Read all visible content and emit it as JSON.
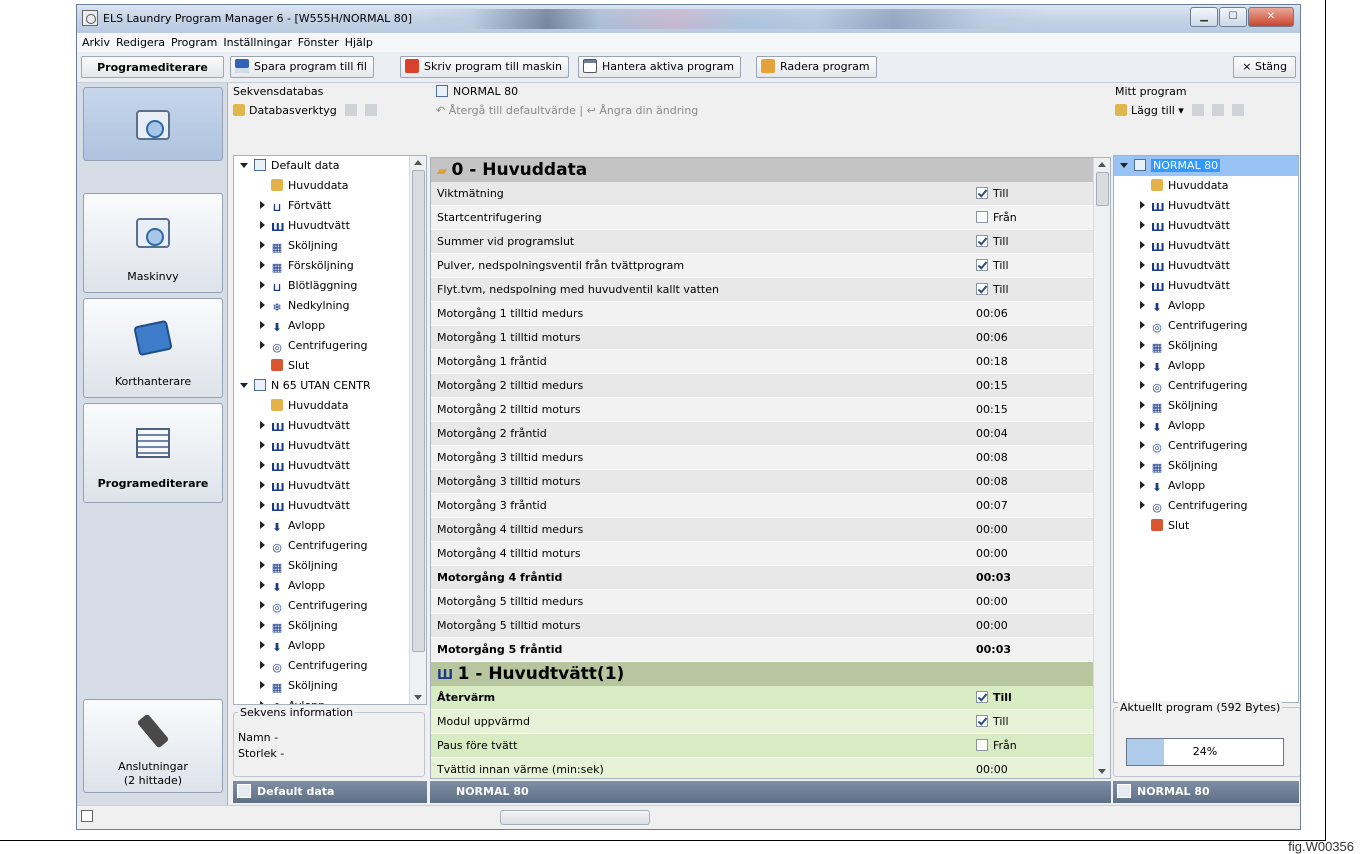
{
  "window": {
    "title": "ELS Laundry Program Manager 6 - [W555H/NORMAL 80]"
  },
  "menu": [
    "Arkiv",
    "Redigera",
    "Program",
    "Inställningar",
    "Fönster",
    "Hjälp"
  ],
  "toolbar": {
    "section_label": "Programediterare",
    "save": "Spara program till fil",
    "write": "Skriv program till maskin",
    "manage": "Hantera aktiva program",
    "delete": "Radera program",
    "close": "× Stäng"
  },
  "nav": {
    "machine_view": "Maskinvy",
    "card_handler": "Korthanterare",
    "program_editor": "Programediterare",
    "connections_l1": "Anslutningar",
    "connections_l2": "(2 hittade)"
  },
  "seqdb": {
    "header": "Sekvensdatabas",
    "tool": "Databasverktyg",
    "tree": [
      {
        "level": 0,
        "arrow": "open",
        "icon": "program",
        "label": "Default data"
      },
      {
        "level": 1,
        "arrow": "none",
        "icon": "folder",
        "label": "Huvuddata"
      },
      {
        "level": 1,
        "arrow": "closed",
        "icon": "glyph",
        "glyph": "⊔",
        "label": "Förtvätt"
      },
      {
        "level": 1,
        "arrow": "closed",
        "icon": "glyph",
        "glyph": "Ш",
        "label": "Huvudtvätt"
      },
      {
        "level": 1,
        "arrow": "closed",
        "icon": "glyph",
        "glyph": "▦",
        "label": "Sköljning"
      },
      {
        "level": 1,
        "arrow": "closed",
        "icon": "glyph",
        "glyph": "▦",
        "label": "Försköljning"
      },
      {
        "level": 1,
        "arrow": "closed",
        "icon": "glyph",
        "glyph": "⊔",
        "label": "Blötläggning"
      },
      {
        "level": 1,
        "arrow": "closed",
        "icon": "glyph",
        "glyph": "❄",
        "label": "Nedkylning"
      },
      {
        "level": 1,
        "arrow": "closed",
        "icon": "glyph",
        "glyph": "⬇",
        "label": "Avlopp"
      },
      {
        "level": 1,
        "arrow": "closed",
        "icon": "glyph",
        "glyph": "◎",
        "label": "Centrifugering"
      },
      {
        "level": 1,
        "arrow": "none",
        "icon": "slut",
        "label": "Slut"
      },
      {
        "level": 0,
        "arrow": "open",
        "icon": "program",
        "label": "N 65 UTAN CENTR"
      },
      {
        "level": 1,
        "arrow": "none",
        "icon": "folder",
        "label": "Huvuddata"
      },
      {
        "level": 1,
        "arrow": "closed",
        "icon": "glyph",
        "glyph": "Ш",
        "label": "Huvudtvätt"
      },
      {
        "level": 1,
        "arrow": "closed",
        "icon": "glyph",
        "glyph": "Ш",
        "label": "Huvudtvätt"
      },
      {
        "level": 1,
        "arrow": "closed",
        "icon": "glyph",
        "glyph": "Ш",
        "label": "Huvudtvätt"
      },
      {
        "level": 1,
        "arrow": "closed",
        "icon": "glyph",
        "glyph": "Ш",
        "label": "Huvudtvätt"
      },
      {
        "level": 1,
        "arrow": "closed",
        "icon": "glyph",
        "glyph": "Ш",
        "label": "Huvudtvätt"
      },
      {
        "level": 1,
        "arrow": "closed",
        "icon": "glyph",
        "glyph": "⬇",
        "label": "Avlopp"
      },
      {
        "level": 1,
        "arrow": "closed",
        "icon": "glyph",
        "glyph": "◎",
        "label": "Centrifugering"
      },
      {
        "level": 1,
        "arrow": "closed",
        "icon": "glyph",
        "glyph": "▦",
        "label": "Sköljning"
      },
      {
        "level": 1,
        "arrow": "closed",
        "icon": "glyph",
        "glyph": "⬇",
        "label": "Avlopp"
      },
      {
        "level": 1,
        "arrow": "closed",
        "icon": "glyph",
        "glyph": "◎",
        "label": "Centrifugering"
      },
      {
        "level": 1,
        "arrow": "closed",
        "icon": "glyph",
        "glyph": "▦",
        "label": "Sköljning"
      },
      {
        "level": 1,
        "arrow": "closed",
        "icon": "glyph",
        "glyph": "⬇",
        "label": "Avlopp"
      },
      {
        "level": 1,
        "arrow": "closed",
        "icon": "glyph",
        "glyph": "◎",
        "label": "Centrifugering"
      },
      {
        "level": 1,
        "arrow": "closed",
        "icon": "glyph",
        "glyph": "▦",
        "label": "Sköljning"
      },
      {
        "level": 1,
        "arrow": "closed",
        "icon": "glyph",
        "glyph": "⬇",
        "label": "Avlopp"
      }
    ],
    "info_title": "Sekvens information",
    "info_name": "Namn   -",
    "info_size": "Storlek  -",
    "footer": "Default data"
  },
  "editor": {
    "title": "NORMAL 80",
    "reset": "Återgå till defaultvärde",
    "undo": "Ångra din ändring",
    "sections": [
      {
        "title": "0 - Huvuddata",
        "color": "gray",
        "rows": [
          {
            "name": "Viktmätning",
            "check": true,
            "value": "Till"
          },
          {
            "name": "Startcentrifugering",
            "check": false,
            "value": "Från"
          },
          {
            "name": "Summer vid programslut",
            "check": true,
            "value": "Till"
          },
          {
            "name": "Pulver, nedspolningsventil från tvättprogram",
            "check": true,
            "value": "Till"
          },
          {
            "name": "Flyt.tvm, nedspolning med huvudventil kallt vatten",
            "check": true,
            "value": "Till"
          },
          {
            "name": "Motorgång 1 tilltid medurs",
            "value": "00:06"
          },
          {
            "name": "Motorgång 1 tilltid moturs",
            "value": "00:06"
          },
          {
            "name": "Motorgång 1 fråntid",
            "value": "00:18"
          },
          {
            "name": "Motorgång 2 tilltid medurs",
            "value": "00:15"
          },
          {
            "name": "Motorgång 2 tilltid moturs",
            "value": "00:15"
          },
          {
            "name": "Motorgång 2 fråntid",
            "value": "00:04"
          },
          {
            "name": "Motorgång 3 tilltid medurs",
            "value": "00:08"
          },
          {
            "name": "Motorgång 3 tilltid moturs",
            "value": "00:08"
          },
          {
            "name": "Motorgång 3 fråntid",
            "value": "00:07"
          },
          {
            "name": "Motorgång 4 tilltid medurs",
            "value": "00:00"
          },
          {
            "name": "Motorgång 4 tilltid moturs",
            "value": "00:00"
          },
          {
            "name": "Motorgång 4 fråntid",
            "value": "00:03",
            "bold": true
          },
          {
            "name": "Motorgång 5 tilltid medurs",
            "value": "00:00"
          },
          {
            "name": "Motorgång 5 tilltid moturs",
            "value": "00:00"
          },
          {
            "name": "Motorgång 5 fråntid",
            "value": "00:03",
            "bold": true
          }
        ]
      },
      {
        "title": "1 - Huvudtvätt(1)",
        "color": "green",
        "rows": [
          {
            "name": "Återvärm",
            "check": true,
            "value": "Till",
            "bold": true
          },
          {
            "name": "Modul uppvärmd",
            "check": true,
            "value": "Till"
          },
          {
            "name": "Paus före tvätt",
            "check": false,
            "value": "Från"
          },
          {
            "name": "Tvättid innan värme (min:sek)",
            "value": "00:00"
          }
        ]
      }
    ],
    "footer": "NORMAL 80"
  },
  "myprog": {
    "header": "Mitt program",
    "add": "Lägg till ▾",
    "tree": [
      {
        "level": 0,
        "arrow": "open",
        "icon": "program",
        "label": "NORMAL 80",
        "selected": true
      },
      {
        "level": 1,
        "arrow": "none",
        "icon": "folder",
        "label": "Huvuddata"
      },
      {
        "level": 1,
        "arrow": "closed",
        "icon": "glyph",
        "glyph": "Ш",
        "label": "Huvudtvätt"
      },
      {
        "level": 1,
        "arrow": "closed",
        "icon": "glyph",
        "glyph": "Ш",
        "label": "Huvudtvätt"
      },
      {
        "level": 1,
        "arrow": "closed",
        "icon": "glyph",
        "glyph": "Ш",
        "label": "Huvudtvätt"
      },
      {
        "level": 1,
        "arrow": "closed",
        "icon": "glyph",
        "glyph": "Ш",
        "label": "Huvudtvätt"
      },
      {
        "level": 1,
        "arrow": "closed",
        "icon": "glyph",
        "glyph": "Ш",
        "label": "Huvudtvätt"
      },
      {
        "level": 1,
        "arrow": "closed",
        "icon": "glyph",
        "glyph": "⬇",
        "label": "Avlopp"
      },
      {
        "level": 1,
        "arrow": "closed",
        "icon": "glyph",
        "glyph": "◎",
        "label": "Centrifugering"
      },
      {
        "level": 1,
        "arrow": "closed",
        "icon": "glyph",
        "glyph": "▦",
        "label": "Sköljning"
      },
      {
        "level": 1,
        "arrow": "closed",
        "icon": "glyph",
        "glyph": "⬇",
        "label": "Avlopp"
      },
      {
        "level": 1,
        "arrow": "closed",
        "icon": "glyph",
        "glyph": "◎",
        "label": "Centrifugering"
      },
      {
        "level": 1,
        "arrow": "closed",
        "icon": "glyph",
        "glyph": "▦",
        "label": "Sköljning"
      },
      {
        "level": 1,
        "arrow": "closed",
        "icon": "glyph",
        "glyph": "⬇",
        "label": "Avlopp"
      },
      {
        "level": 1,
        "arrow": "closed",
        "icon": "glyph",
        "glyph": "◎",
        "label": "Centrifugering"
      },
      {
        "level": 1,
        "arrow": "closed",
        "icon": "glyph",
        "glyph": "▦",
        "label": "Sköljning"
      },
      {
        "level": 1,
        "arrow": "closed",
        "icon": "glyph",
        "glyph": "⬇",
        "label": "Avlopp"
      },
      {
        "level": 1,
        "arrow": "closed",
        "icon": "glyph",
        "glyph": "◎",
        "label": "Centrifugering"
      },
      {
        "level": 1,
        "arrow": "none",
        "icon": "slut",
        "label": "Slut"
      }
    ],
    "current_title": "Aktuellt program (592 Bytes)",
    "progress_fraction": 0.24,
    "progress_text": "24%",
    "footer": "NORMAL 80"
  },
  "caption": "fig.W00356"
}
